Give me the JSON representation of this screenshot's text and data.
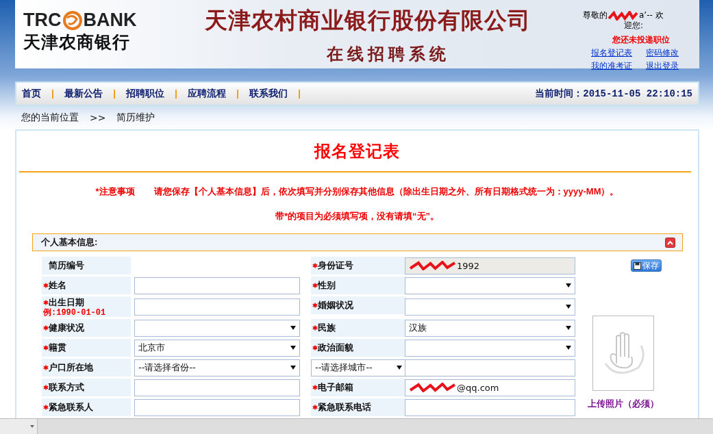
{
  "header": {
    "logo": {
      "left": "TRC",
      "right": "BANK",
      "subtitle": "天津农商银行"
    },
    "title": "天津农村商业银行股份有限公司",
    "subtitle": "在线招聘系统",
    "user": {
      "greeting_start": "尊敬的",
      "greeting_end": "a’-- 欢",
      "greeting_line2": "迎您:",
      "status": "您还未投递职位",
      "links": [
        "报名登记表",
        "密码修改",
        "我的准考证",
        "退出登录"
      ]
    }
  },
  "nav": {
    "items": [
      "首页",
      "最新公告",
      "招聘职位",
      "应聘流程",
      "联系我们"
    ],
    "time": "当前时间：2015-11-05 22:10:15"
  },
  "breadcrumb": {
    "label": "您的当前位置",
    "separator": ">>",
    "current": "简历维护"
  },
  "form": {
    "title": "报名登记表",
    "notice_title": "*注意事项",
    "notice": "请您保存【个人基本信息】后，依次填写并分别保存其他信息（除出生日期之外、所有日期格式统一为：yyyy-MM）。",
    "notice2": "带*的项目为必须填写项，没有请填“无”。",
    "section": {
      "title": "个人基本信息:",
      "expanded": true
    },
    "save_button": "保存",
    "upload_label": "上传照片（必须）",
    "rows": [
      [
        {
          "kind": "label",
          "text": "简历编号",
          "required": false
        },
        {
          "kind": "empty"
        },
        {
          "kind": "label",
          "text": "身份证号",
          "required": true
        },
        {
          "kind": "readonly",
          "value": "1992"
        }
      ],
      [
        {
          "kind": "label",
          "text": "姓名",
          "required": true
        },
        {
          "kind": "text"
        },
        {
          "kind": "label",
          "text": "性别",
          "required": true
        },
        {
          "kind": "select"
        }
      ],
      [
        {
          "kind": "label",
          "text": "出生日期",
          "required": true,
          "hint": "例:1990-01-01"
        },
        {
          "kind": "text"
        },
        {
          "kind": "label",
          "text": "婚姻状况",
          "required": true
        },
        {
          "kind": "select"
        }
      ],
      [
        {
          "kind": "label",
          "text": "健康状况",
          "required": true
        },
        {
          "kind": "select"
        },
        {
          "kind": "label",
          "text": "民族",
          "required": true
        },
        {
          "kind": "select",
          "value": "汉族"
        }
      ],
      [
        {
          "kind": "label",
          "text": "籍贯",
          "required": true
        },
        {
          "kind": "select",
          "value": "北京市"
        },
        {
          "kind": "label",
          "text": "政治面貌",
          "required": true
        },
        {
          "kind": "select"
        }
      ],
      [
        {
          "kind": "label",
          "text": "户口所在地",
          "required": true
        },
        {
          "kind": "select",
          "value": "--请选择省份--"
        },
        {
          "kind": "select",
          "value": "--请选择城市--"
        },
        {
          "kind": "text"
        }
      ],
      [
        {
          "kind": "label",
          "text": "联系方式",
          "required": true
        },
        {
          "kind": "text"
        },
        {
          "kind": "label",
          "text": "电子邮箱",
          "required": true
        },
        {
          "kind": "text",
          "value": "@qq.com"
        }
      ],
      [
        {
          "kind": "label",
          "text": "紧急联系人",
          "required": true
        },
        {
          "kind": "text"
        },
        {
          "kind": "label",
          "text": "紧急联系电话",
          "required": true
        },
        {
          "kind": "text"
        }
      ]
    ]
  }
}
